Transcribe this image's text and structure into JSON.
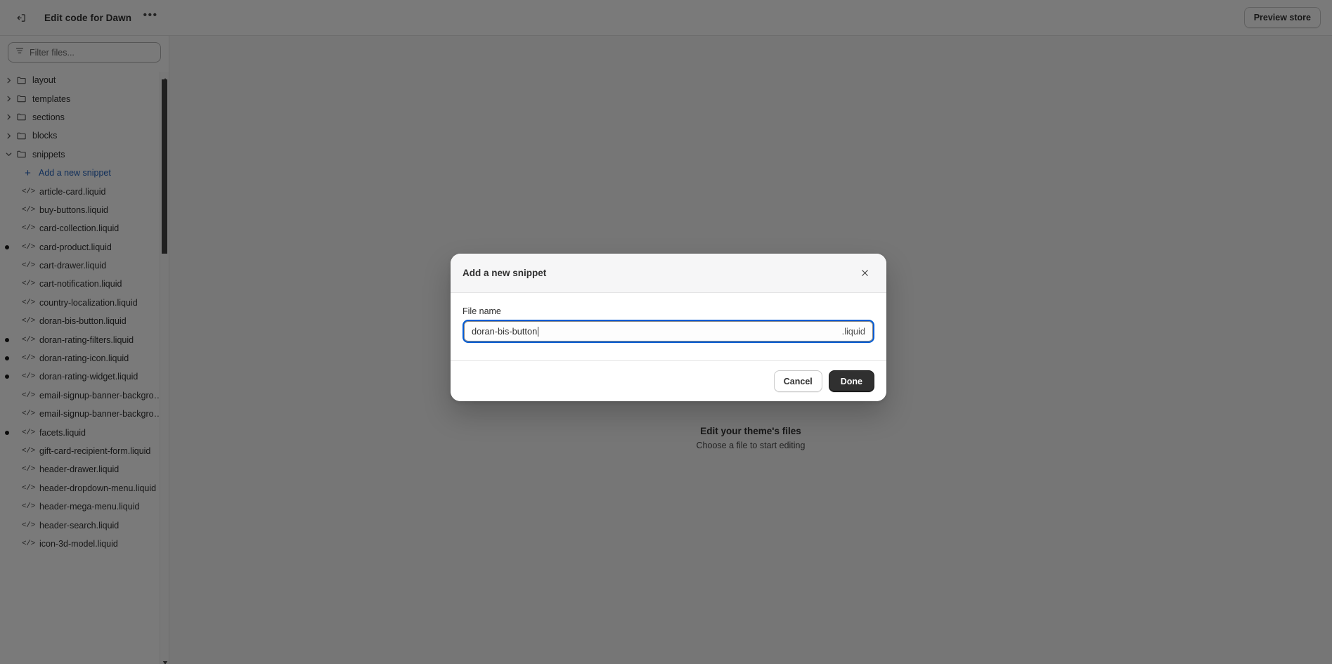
{
  "topbar": {
    "back_icon": "exit-icon",
    "title": "Edit code for Dawn",
    "more_icon": "ellipsis-icon",
    "preview_label": "Preview store"
  },
  "sidebar": {
    "filter": {
      "icon": "filter-icon",
      "placeholder": "Filter files...",
      "value": ""
    },
    "folders": [
      {
        "label": "layout",
        "expanded": false
      },
      {
        "label": "templates",
        "expanded": false
      },
      {
        "label": "sections",
        "expanded": false
      },
      {
        "label": "blocks",
        "expanded": false
      },
      {
        "label": "snippets",
        "expanded": true
      }
    ],
    "add_snippet_label": "Add a new snippet",
    "files": [
      {
        "label": "article-card.liquid",
        "modified": false
      },
      {
        "label": "buy-buttons.liquid",
        "modified": false
      },
      {
        "label": "card-collection.liquid",
        "modified": false
      },
      {
        "label": "card-product.liquid",
        "modified": true
      },
      {
        "label": "cart-drawer.liquid",
        "modified": false
      },
      {
        "label": "cart-notification.liquid",
        "modified": false
      },
      {
        "label": "country-localization.liquid",
        "modified": false
      },
      {
        "label": "doran-bis-button.liquid",
        "modified": false
      },
      {
        "label": "doran-rating-filters.liquid",
        "modified": true
      },
      {
        "label": "doran-rating-icon.liquid",
        "modified": true
      },
      {
        "label": "doran-rating-widget.liquid",
        "modified": true
      },
      {
        "label": "email-signup-banner-background-m...",
        "modified": false
      },
      {
        "label": "email-signup-banner-background.liq...",
        "modified": false
      },
      {
        "label": "facets.liquid",
        "modified": true
      },
      {
        "label": "gift-card-recipient-form.liquid",
        "modified": false
      },
      {
        "label": "header-drawer.liquid",
        "modified": false
      },
      {
        "label": "header-dropdown-menu.liquid",
        "modified": false
      },
      {
        "label": "header-mega-menu.liquid",
        "modified": false
      },
      {
        "label": "header-search.liquid",
        "modified": false
      },
      {
        "label": "icon-3d-model.liquid",
        "modified": false
      }
    ],
    "scrollbar": {
      "up_icon": "caret-up-icon",
      "down_icon": "caret-down-icon"
    }
  },
  "main": {
    "illustration": "code-editor-illustration",
    "empty_title": "Edit your theme's files",
    "empty_subtitle": "Choose a file to start editing"
  },
  "modal": {
    "title": "Add a new snippet",
    "close_icon": "close-icon",
    "field_label": "File name",
    "input_value": "doran-bis-button",
    "input_placeholder": "",
    "input_suffix": ".liquid",
    "cancel_label": "Cancel",
    "done_label": "Done"
  },
  "colors": {
    "accent_link": "#2463bc",
    "focus_ring": "#005bd3",
    "primary_button_bg": "#303030",
    "canvas": "#f6f6f7",
    "illustration_dark": "#0f1a2e",
    "illustration_blue": "#1f3057"
  }
}
